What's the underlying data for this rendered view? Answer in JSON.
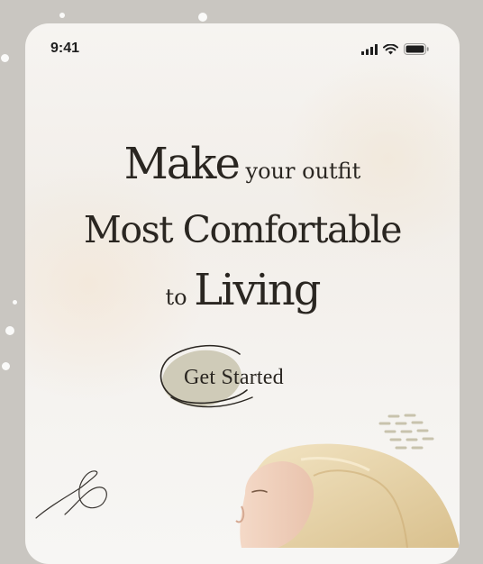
{
  "status_bar": {
    "time": "9:41",
    "icons": [
      "signal-icon",
      "wifi-icon",
      "battery-icon"
    ]
  },
  "hero": {
    "line1_big": "Make",
    "line1_small": " your outfit",
    "line2": "Most Comfortable",
    "line3_small": "to ",
    "line3_big": "Living"
  },
  "cta": {
    "label": "Get Started"
  },
  "colors": {
    "background": "#c9c6c1",
    "screen": "#f5f3f0",
    "text": "#2a2621",
    "accent_blob": "#cfcbb8",
    "dashes": "#c8c3ad",
    "hair": "#e9d7ad"
  }
}
